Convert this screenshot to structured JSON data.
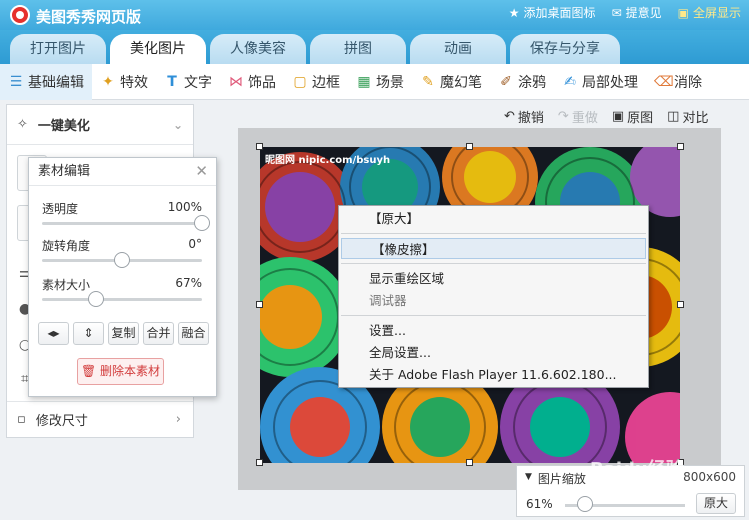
{
  "app": {
    "title": "美图秀秀网页版"
  },
  "top_links": {
    "add_desktop": "添加桌面图标",
    "feedback": "提意见",
    "fullscreen": "全屏显示"
  },
  "tabs": [
    "打开图片",
    "美化图片",
    "人像美容",
    "拼图",
    "动画",
    "保存与分享"
  ],
  "active_tab": 1,
  "toolbar": [
    "基础编辑",
    "特效",
    "文字",
    "饰品",
    "边框",
    "场景",
    "魔幻笔",
    "涂鸦",
    "局部处理",
    "消除"
  ],
  "left_panel": {
    "one_click": "一键美化",
    "resize": "修改尺寸"
  },
  "material_dialog": {
    "title": "素材编辑",
    "sliders": [
      {
        "label": "透明度",
        "value": "100%",
        "level": 1.0
      },
      {
        "label": "旋转角度",
        "value": "0°",
        "level": 0.5
      },
      {
        "label": "素材大小",
        "value": "67%",
        "level": 0.33
      }
    ],
    "buttons": {
      "flip_h": "flip-horizontal",
      "flip_v": "flip-vertical",
      "copy": "复制",
      "merge": "合并",
      "blend": "融合"
    },
    "delete": "删除本素材"
  },
  "undo_bar": {
    "undo": "撤销",
    "redo": "重做",
    "original": "原图",
    "compare": "对比"
  },
  "photo": {
    "watermark": "昵图网 nipic.com/bsuyh"
  },
  "context_menu": {
    "items": [
      "【原大】",
      "【橡皮擦】",
      "显示重绘区域",
      "调试器",
      "设置...",
      "全局设置...",
      "关于 Adobe Flash Player 11.6.602.180..."
    ],
    "highlighted": 1
  },
  "zoom": {
    "label": "图片缩放",
    "dimensions": "800x600",
    "percent": "61%",
    "level": 0.1,
    "reset": "原大"
  },
  "watermark_brand": {
    "text": "Baidu经验",
    "sub": "jingyan.baidu.com"
  }
}
